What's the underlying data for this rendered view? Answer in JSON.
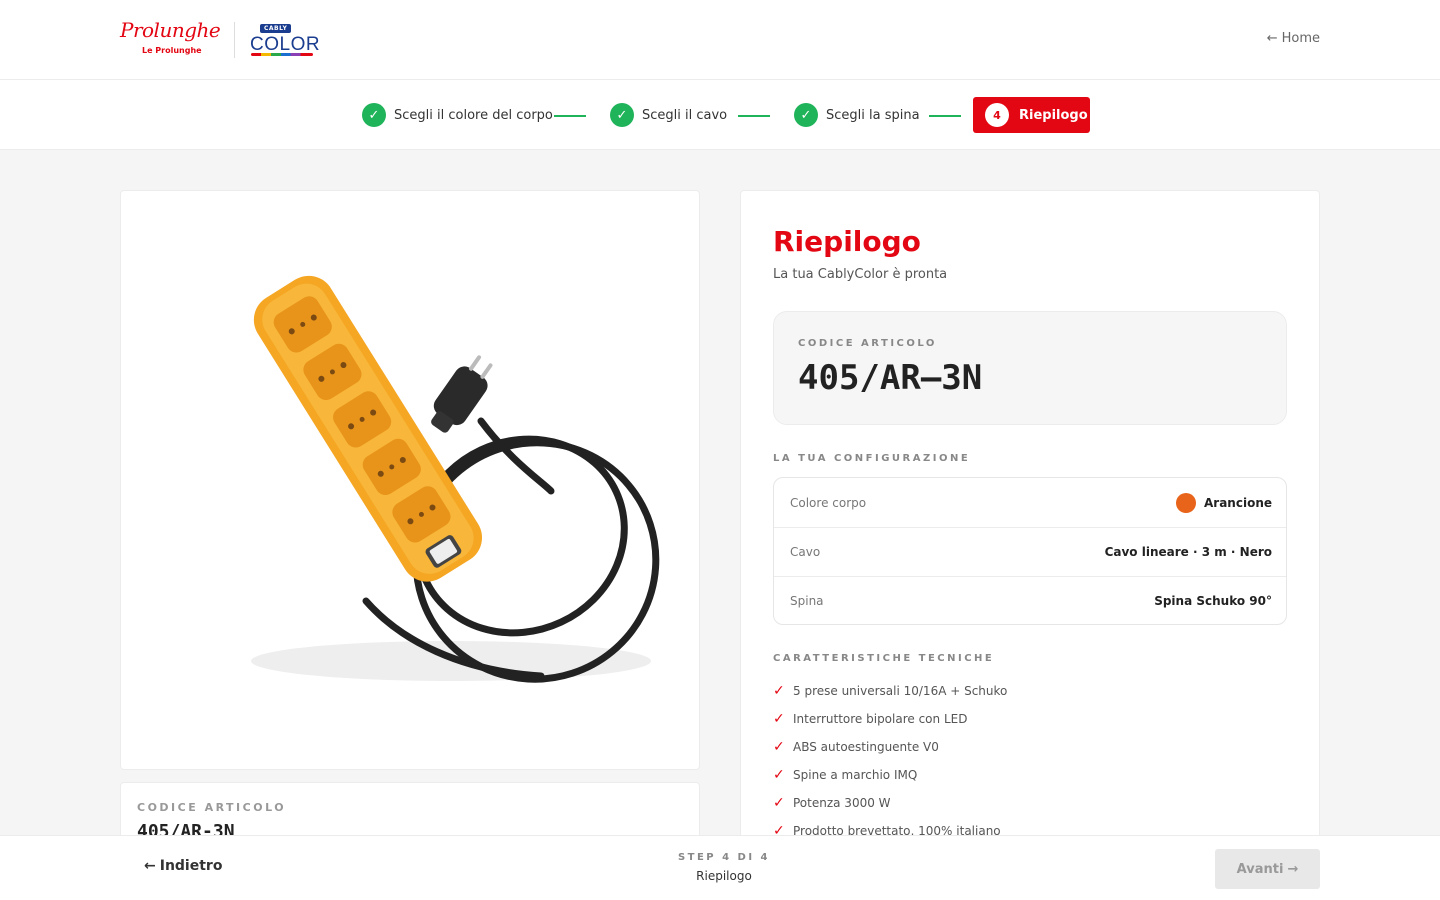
{
  "header": {
    "logo_prolunghe_script": "Prolunghe",
    "logo_prolunghe_sub": "Le Prolunghe",
    "logo_cably_badge": "CABLY",
    "logo_cably_word": "COLOR",
    "home_label": "Home"
  },
  "stepper": {
    "steps": [
      {
        "label": "Scegli il colore del corpo",
        "state": "done"
      },
      {
        "label": "Scegli il cavo",
        "state": "done"
      },
      {
        "label": "Scegli la spina",
        "state": "done"
      },
      {
        "label": "Riepilogo",
        "number": "4",
        "state": "active"
      }
    ],
    "done_color": "#1fb35a",
    "active_color": "#e30613"
  },
  "left": {
    "product_alt": "Multipresa arancione con cavo nero",
    "code_label": "CODICE ARTICOLO",
    "code_value": "405/AR-3N"
  },
  "summary": {
    "title": "Riepilogo",
    "subtitle": "La tua CablyColor è pronta",
    "code_label": "CODICE ARTICOLO",
    "code_value": "405/AR–3N",
    "config_label": "LA TUA CONFIGURAZIONE",
    "config": [
      {
        "key": "Colore corpo",
        "value": "Arancione",
        "swatch": "#e8641a"
      },
      {
        "key": "Cavo",
        "value": "Cavo lineare · 3 m · Nero"
      },
      {
        "key": "Spina",
        "value": "Spina Schuko 90°"
      }
    ],
    "features_label": "CARATTERISTICHE TECNICHE",
    "features": [
      "5 prese universali 10/16A + Schuko",
      "Interruttore bipolare con LED",
      "ABS autoestinguente V0",
      "Spine a marchio IMQ",
      "Potenza 3000 W",
      "Prodotto brevettato, 100% italiano"
    ]
  },
  "footer": {
    "back_label": "Indietro",
    "step_of": "STEP 4 DI 4",
    "step_name": "Riepilogo",
    "next_label": "Avanti"
  }
}
